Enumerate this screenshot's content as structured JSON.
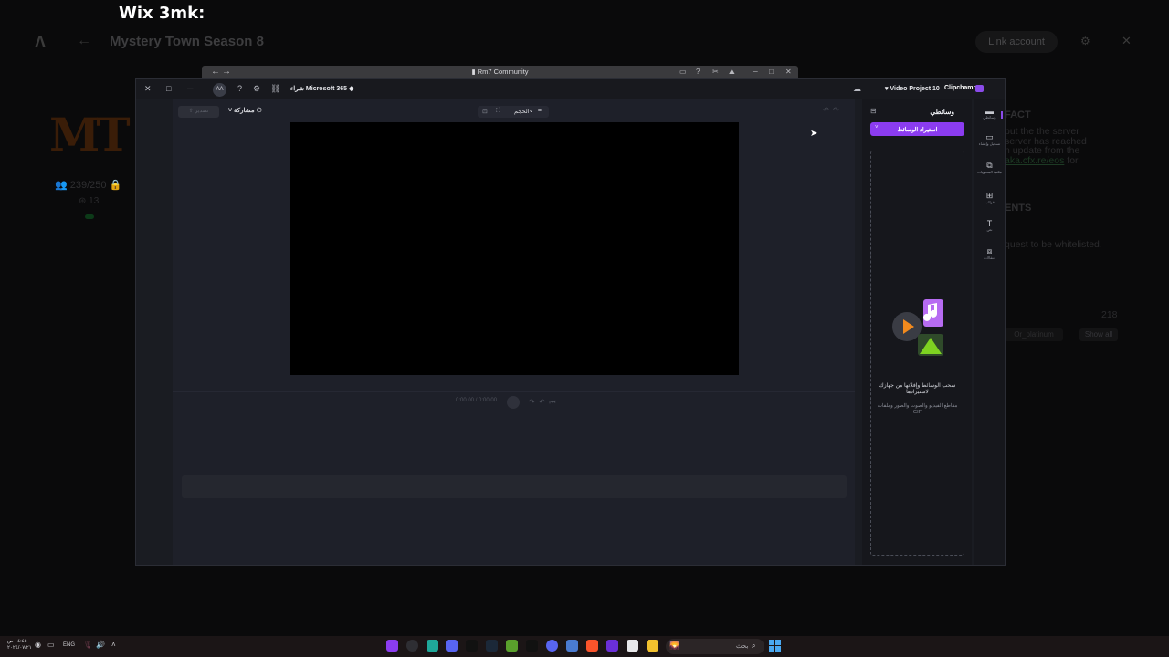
{
  "overlay_caption": "Wix 3mk:",
  "launcher": {
    "logo": "Λ",
    "server_title": "Mystery Town Season 8",
    "link_account": "Link account",
    "server_logo_text": "MT",
    "players": "239/250",
    "ping": "13",
    "fact_heading": "FACT",
    "fact_text_1": "but the the server",
    "fact_text_2": "server has reached",
    "fact_text_3": "n update from the",
    "fact_link": "aka.cfx.re/eos",
    "fact_text_4": "for",
    "ents_heading": "ENTS",
    "ents_text": "quest to be whitelisted.",
    "count": "218",
    "tag": "Or_platinum",
    "show_all": "Show all"
  },
  "browser": {
    "title": "Rm7 Community"
  },
  "clipchamp": {
    "buy_label": "شراء Microsoft 365",
    "avatar": "AA",
    "project_name": "Video Project 10",
    "brand": "Clipchamp",
    "export_label": "تصدير",
    "share_label": "مشاركة",
    "size_label": "الحجم",
    "time_current": "0:00.00",
    "time_total": "0:00.00",
    "media_title": "وسائطي",
    "import_label": "استيراد الوسائط",
    "drop_title": "سحب الوسائط وإفلاتها من جهازك لاستيرادها",
    "drop_sub": "مقاطع الفيديو والصوت والصور وملفات GIF",
    "rail": [
      {
        "icon": "folder-icon",
        "label": "وسائطي"
      },
      {
        "icon": "camera-icon",
        "label": "تسجيل وإنشاء"
      },
      {
        "icon": "content-library-icon",
        "label": "مكتبة المحتويات"
      },
      {
        "icon": "templates-icon",
        "label": "قوالب"
      },
      {
        "icon": "text-icon",
        "label": "نص"
      },
      {
        "icon": "transitions-icon",
        "label": "انتقالات"
      }
    ]
  },
  "taskbar": {
    "time": "٠٤:٤٥ ص",
    "date": "٢٠٢٤/٠٧/٢١",
    "lang": "ENG",
    "search_placeholder": "بحث"
  },
  "colors": {
    "accent": "#8b3cf0",
    "preview_bg": "#000000",
    "editor_bg": "#1e2029"
  }
}
